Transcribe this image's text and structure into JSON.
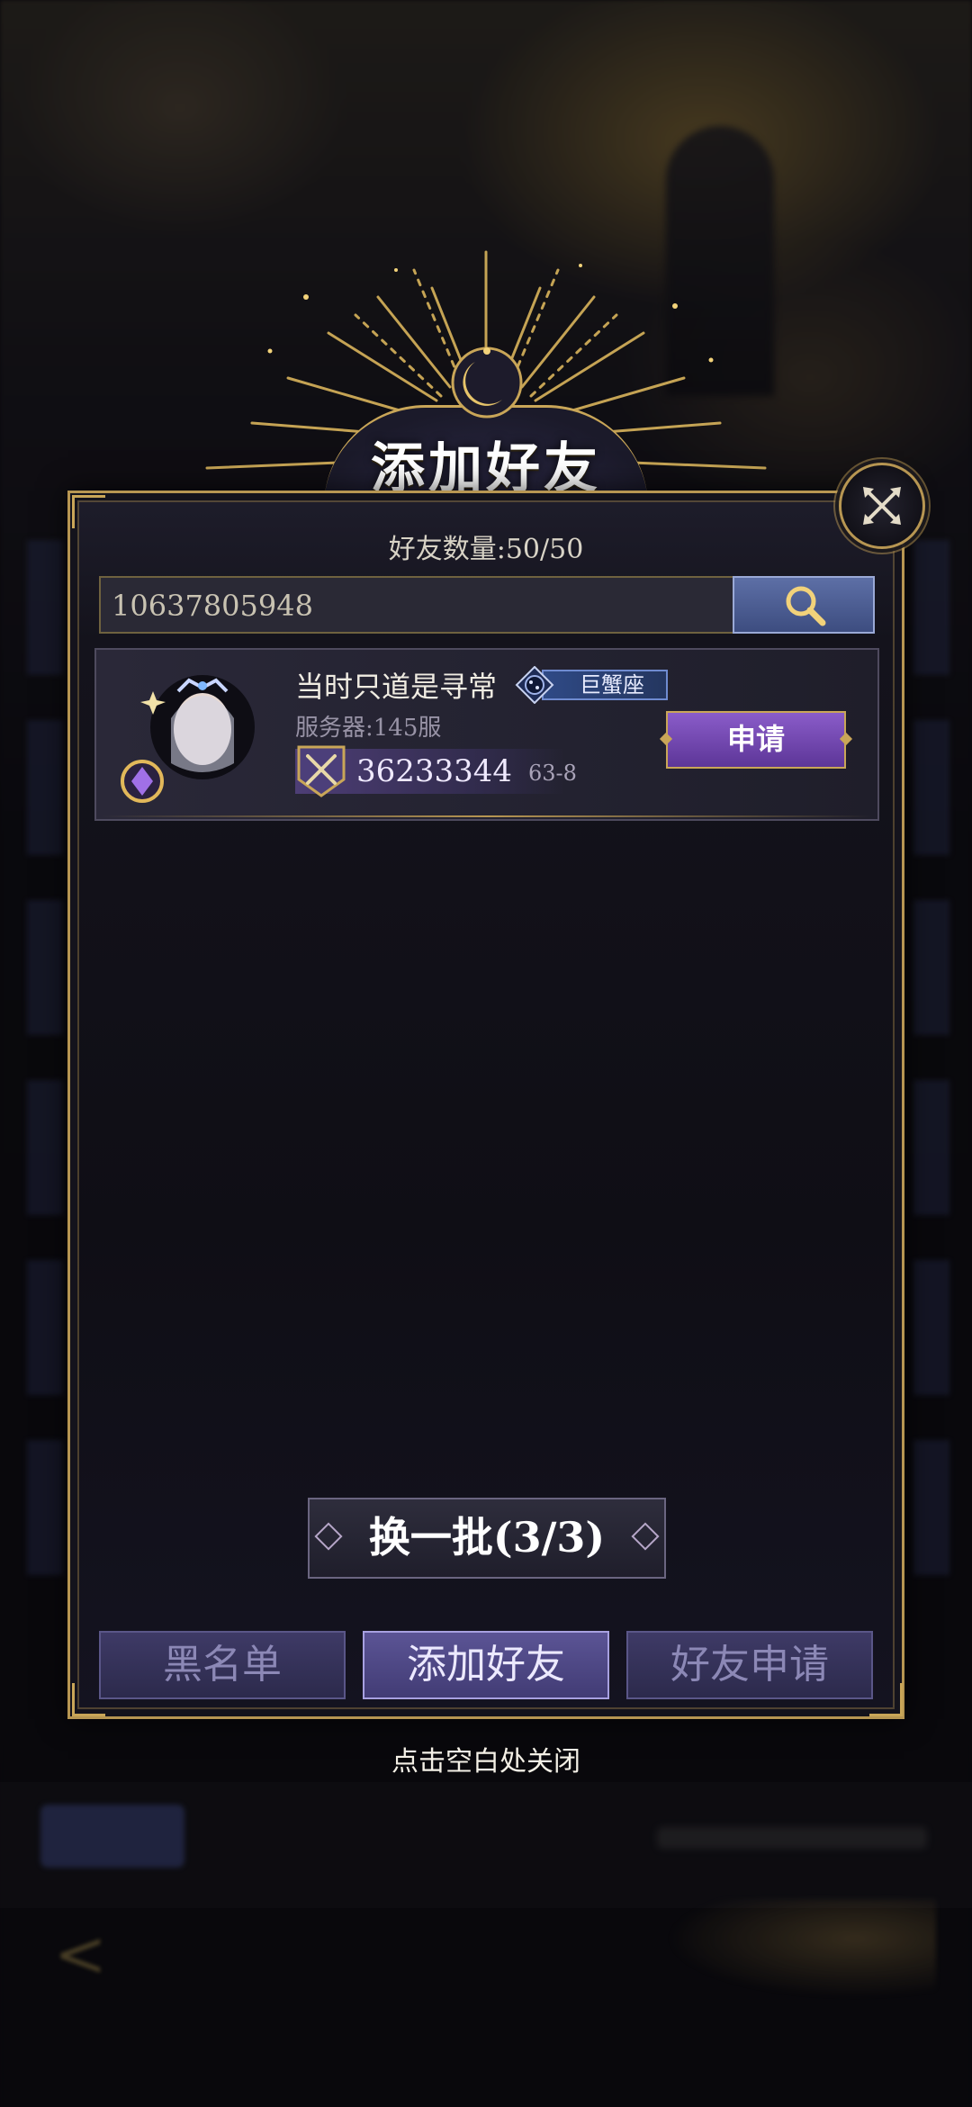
{
  "dialog": {
    "title": "添加好友",
    "friend_count_label": "好友数量:50/50",
    "close_hint": "点击空白处关闭"
  },
  "search": {
    "value": "10637805948",
    "placeholder": ""
  },
  "result": {
    "player_name": "当时只道是寻常",
    "zodiac": "巨蟹座",
    "server": "服务器:145服",
    "power": "36233344",
    "level": "63-8",
    "apply_label": "申请"
  },
  "refresh_label": "换一批(3/3)",
  "tabs": [
    {
      "label": "黑名单",
      "active": false
    },
    {
      "label": "添加好友",
      "active": true
    },
    {
      "label": "好友申请",
      "active": false
    }
  ],
  "colors": {
    "gold_border": "#b79652",
    "apply_purple": "#7a4fb8",
    "search_blue": "#4a5b90",
    "tab_purple": "#423c75"
  },
  "icons": {
    "close": "close-x-icon",
    "search": "magnifier-icon",
    "zodiac": "cancer-zodiac-icon",
    "power": "crossed-swords-icon"
  }
}
